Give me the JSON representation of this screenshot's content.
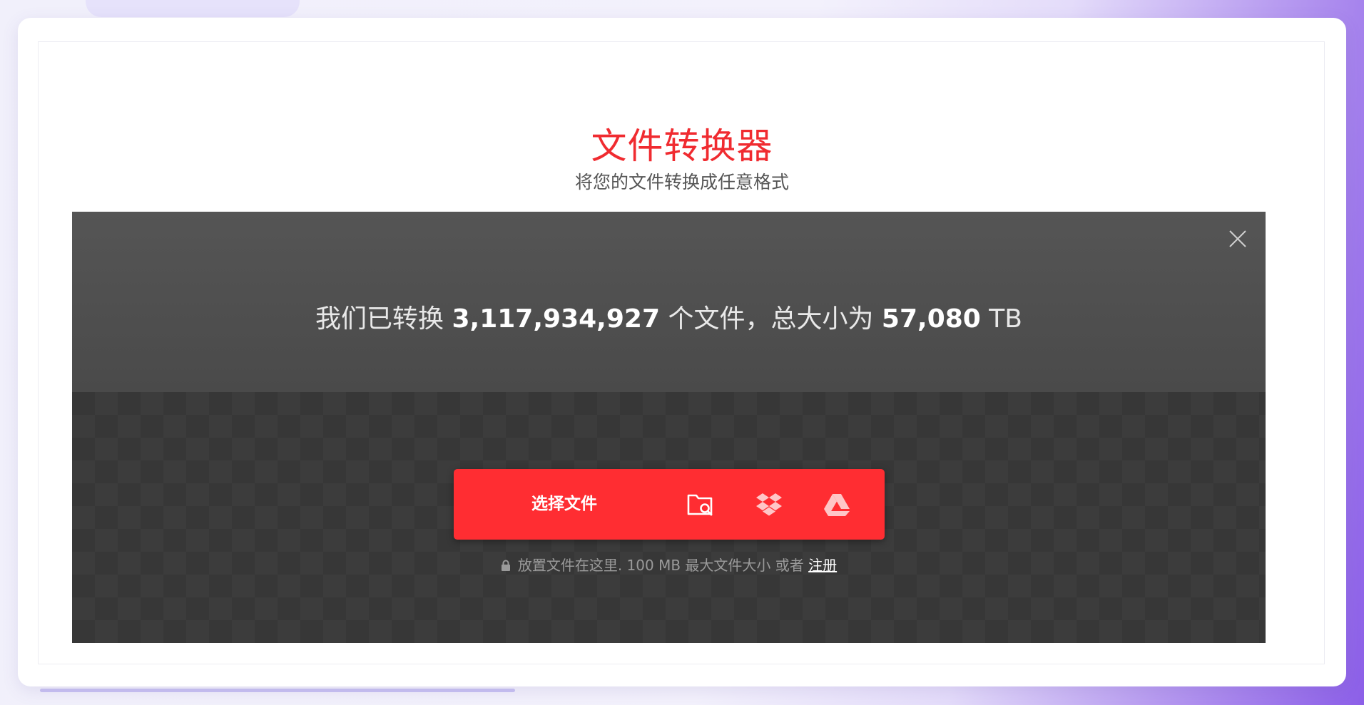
{
  "page": {
    "title": "文件转换器",
    "subtitle": "将您的文件转换成任意格式"
  },
  "stats": {
    "prefix": "我们已转换",
    "file_count": "3,117,934,927",
    "middle": "个文件，总大小为",
    "total_size": "57,080",
    "unit": "TB"
  },
  "uploader": {
    "choose_file_label": "选择文件",
    "sources": [
      {
        "icon": "folder-search-icon",
        "title": "从设备选择"
      },
      {
        "icon": "dropbox-icon",
        "title": "Dropbox"
      },
      {
        "icon": "google-drive-icon",
        "title": "Google Drive"
      }
    ],
    "hint_text": "放置文件在这里. 100 MB 最大文件大小 或者",
    "signup_label": "注册"
  },
  "colors": {
    "accent": "#f02b30",
    "button_red": "#ff2d32",
    "panel_dark": "#4f4f4f",
    "dropzone_dark": "#373737"
  }
}
